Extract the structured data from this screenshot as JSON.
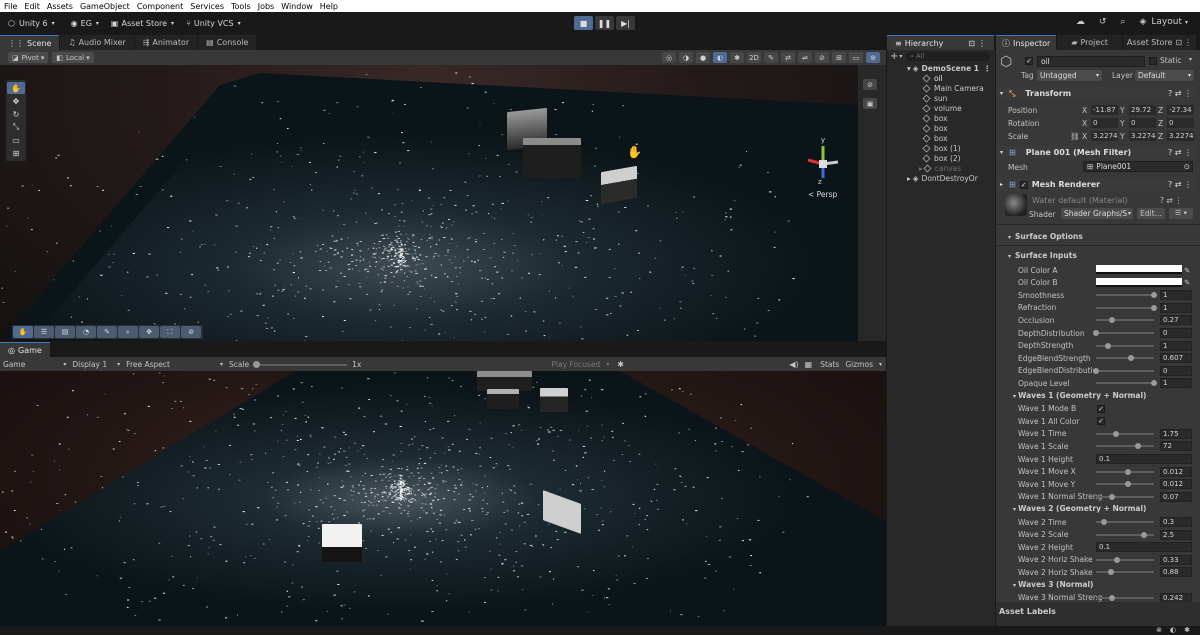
{
  "menu": [
    "File",
    "Edit",
    "Assets",
    "GameObject",
    "Component",
    "Services",
    "Tools",
    "Jobs",
    "Window",
    "Help"
  ],
  "toolbar": {
    "unity_version": "Unity 6",
    "account": "EG",
    "asset_store": "Asset Store",
    "vcs": "Unity VCS",
    "layout": "Layout"
  },
  "scene_tabs": [
    "Scene",
    "Audio Mixer",
    "Animator",
    "Console"
  ],
  "scene_toolbar": {
    "pivot": "Pivot",
    "local": "Local",
    "persp": "< Persp",
    "axis_y": "y",
    "axis_z": "z"
  },
  "game": {
    "tab": "Game",
    "mode": "Game",
    "display": "Display 1",
    "aspect": "Free Aspect",
    "scale_label": "Scale",
    "scale_value": "1x",
    "play_focused": "Play Focused",
    "stats": "Stats",
    "gizmos": "Gizmos"
  },
  "hierarchy": {
    "tab": "Hierarchy",
    "search_placeholder": "All",
    "scene": "DemoScene 1",
    "items": [
      "oil",
      "Main Camera",
      "sun",
      "volume",
      "box",
      "box",
      "box",
      "box (1)",
      "box (2)",
      "canvas"
    ],
    "dont_destroy": "DontDestroyOr"
  },
  "inspector_tabs": [
    "Inspector",
    "Project",
    "Asset Store"
  ],
  "inspector": {
    "object_name": "oil",
    "static_label": "Static",
    "tag_label": "Tag",
    "tag_value": "Untagged",
    "layer_label": "Layer",
    "layer_value": "Default",
    "transform": {
      "title": "Transform",
      "position": {
        "label": "Position",
        "x": "-11.87",
        "y": "29.72",
        "z": "-27.34"
      },
      "rotation": {
        "label": "Rotation",
        "x": "0",
        "y": "0",
        "z": "0"
      },
      "scale": {
        "label": "Scale",
        "x": "3.2274",
        "y": "3.2274",
        "z": "3.2274"
      }
    },
    "mesh_filter": {
      "title": "Plane 001 (Mesh Filter)",
      "mesh_label": "Mesh",
      "mesh_value": "Plane001"
    },
    "mesh_renderer": {
      "title": "Mesh Renderer"
    },
    "material": {
      "name": "Water default (Material)",
      "shader_label": "Shader",
      "shader_value": "Shader Graphs/S",
      "edit": "Edit..."
    },
    "surface_options": "Surface Options",
    "surface_inputs": "Surface Inputs",
    "props": [
      {
        "label": "Oil Color A",
        "kind": "color"
      },
      {
        "label": "Oil Color B",
        "kind": "color"
      },
      {
        "label": "Smoothness",
        "kind": "slider",
        "value": "1",
        "frac": 1.0
      },
      {
        "label": "Refraction",
        "kind": "slider",
        "value": "1",
        "frac": 1.0
      },
      {
        "label": "Occlusion",
        "kind": "slider",
        "value": "0.27",
        "frac": 0.27
      },
      {
        "label": "DepthDistribution",
        "kind": "slider",
        "value": "0",
        "frac": 0.0
      },
      {
        "label": "DepthStrength",
        "kind": "slider",
        "value": "1",
        "frac": 0.2
      },
      {
        "label": "EdgeBlendStrength",
        "kind": "slider",
        "value": "0.607",
        "frac": 0.607
      },
      {
        "label": "EdgeBlendDistributio",
        "kind": "slider",
        "value": "0",
        "frac": 0.0
      },
      {
        "label": "Opaque Level",
        "kind": "slider",
        "value": "1",
        "frac": 1.0
      },
      {
        "label": "Waves 1 (Geometry + Normal)",
        "kind": "group"
      },
      {
        "label": "Wave 1 Mode B",
        "kind": "check"
      },
      {
        "label": "Wave 1 All Color",
        "kind": "check"
      },
      {
        "label": "Wave 1 Time",
        "kind": "slider",
        "value": "1.75",
        "frac": 0.35
      },
      {
        "label": "Wave 1 Scale",
        "kind": "slider",
        "value": "72",
        "frac": 0.72
      },
      {
        "label": "Wave 1 Height",
        "kind": "field",
        "value": "0.1"
      },
      {
        "label": "Wave 1 Move X",
        "kind": "slider",
        "value": "0.012",
        "frac": 0.55
      },
      {
        "label": "Wave 1 Move Y",
        "kind": "slider",
        "value": "0.012",
        "frac": 0.55
      },
      {
        "label": "Wave 1 Normal Streng",
        "kind": "slider",
        "value": "0.07",
        "frac": 0.27
      },
      {
        "label": "Waves 2 (Geometry + Normal)",
        "kind": "group"
      },
      {
        "label": "Wave 2 Time",
        "kind": "slider",
        "value": "0.3",
        "frac": 0.14
      },
      {
        "label": "Wave 2 Scale",
        "kind": "slider",
        "value": "2.5",
        "frac": 0.82
      },
      {
        "label": "Wave 2 Height",
        "kind": "field",
        "value": "0.1"
      },
      {
        "label": "Wave 2 Horiz Shake",
        "kind": "slider",
        "value": "0.33",
        "frac": 0.36
      },
      {
        "label": "Wave 2 Horiz Shake",
        "kind": "slider",
        "value": "0.88",
        "frac": 0.25
      },
      {
        "label": "Waves 3 (Normal)",
        "kind": "group"
      },
      {
        "label": "Wave 3 Normal Streng",
        "kind": "slider",
        "value": "0.242",
        "frac": 0.27
      }
    ],
    "asset_labels": "Asset Labels"
  },
  "colors": {
    "accent": "#4f6a93",
    "water": "#0c1418",
    "bg": "#191919"
  }
}
